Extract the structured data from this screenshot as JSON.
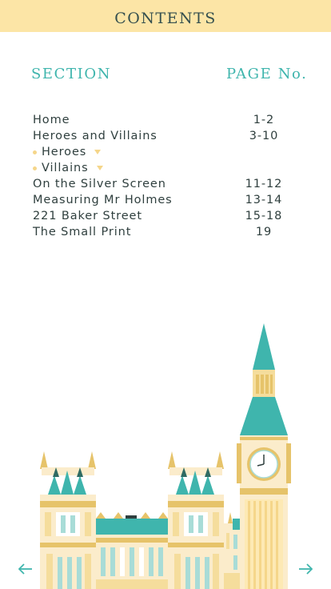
{
  "header": {
    "title": "CONTENTS"
  },
  "columns": {
    "section": "SECTION",
    "page": "PAGE No."
  },
  "toc": [
    {
      "label": "Home",
      "pages": "1-2",
      "sub": false
    },
    {
      "label": "Heroes and Villains",
      "pages": "3-10",
      "sub": false
    },
    {
      "label": "Heroes",
      "pages": "",
      "sub": true
    },
    {
      "label": "Villains",
      "pages": "",
      "sub": true
    },
    {
      "label": "On the Silver Screen",
      "pages": "11-12",
      "sub": false
    },
    {
      "label": "Measuring Mr Holmes",
      "pages": "13-14",
      "sub": false
    },
    {
      "label": "221 Baker Street",
      "pages": "15-18",
      "sub": false
    },
    {
      "label": "The Small Print",
      "pages": "19",
      "sub": false
    }
  ],
  "navigation": {
    "prev_icon": "arrow-left-icon",
    "next_icon": "arrow-right-icon"
  },
  "colors": {
    "header_bg": "#fce5a6",
    "accent_teal": "#3fb5ad",
    "gold": "#e6c36a",
    "cream": "#fbeccb",
    "text": "#2f3f3e"
  }
}
